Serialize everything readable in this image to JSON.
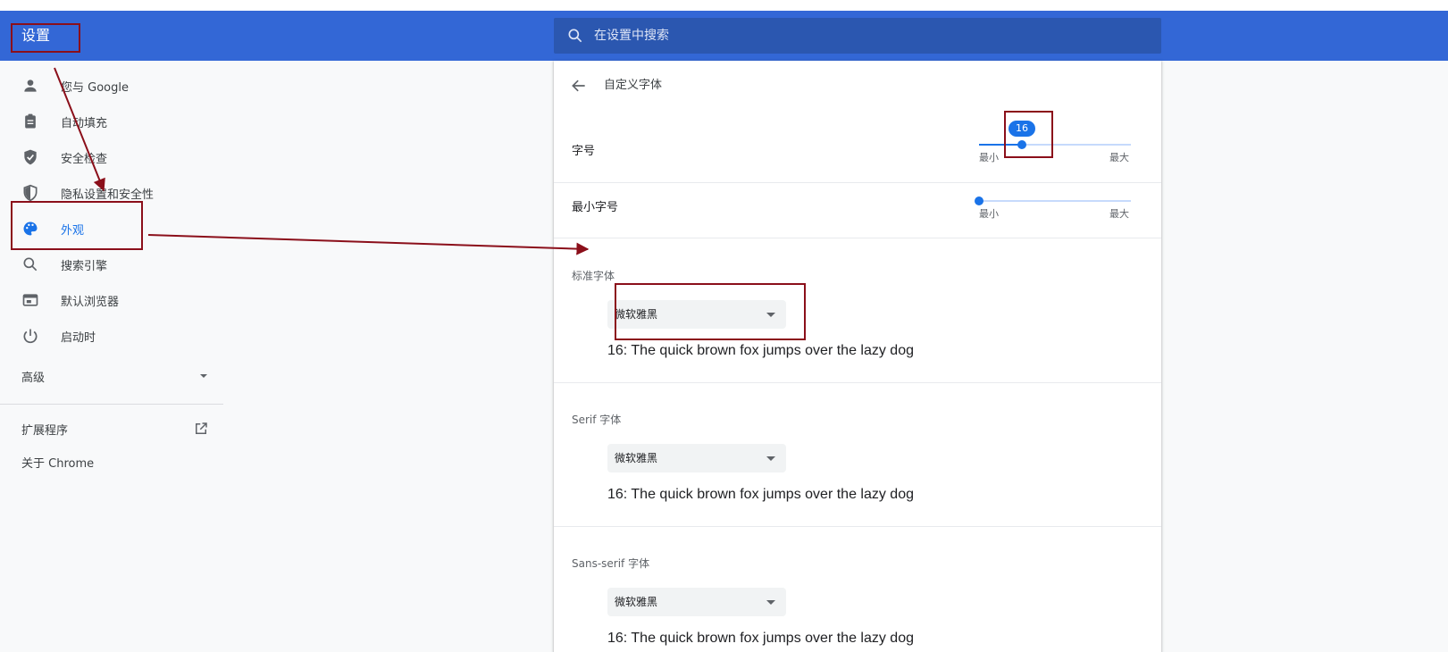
{
  "app": {
    "title": "设置"
  },
  "search": {
    "placeholder": "在设置中搜索",
    "icon": "search-icon"
  },
  "sidebar": {
    "items": [
      {
        "label": "您与 Google",
        "icon": "person-icon"
      },
      {
        "label": "自动填充",
        "icon": "clipboard-icon"
      },
      {
        "label": "安全检查",
        "icon": "shield-check-icon"
      },
      {
        "label": "隐私设置和安全性",
        "icon": "shield-half-icon"
      },
      {
        "label": "外观",
        "icon": "palette-icon",
        "active": true
      },
      {
        "label": "搜索引擎",
        "icon": "search-icon"
      },
      {
        "label": "默认浏览器",
        "icon": "browser-icon"
      },
      {
        "label": "启动时",
        "icon": "power-icon"
      }
    ],
    "advanced_label": "高级",
    "extensions_label": "扩展程序",
    "about_label": "关于 Chrome"
  },
  "subpage": {
    "title": "自定义字体",
    "font_size": {
      "label": "字号",
      "value": "16",
      "position_fraction": 0.28,
      "min_label": "最小",
      "max_label": "最大"
    },
    "min_font_size": {
      "label": "最小字号",
      "position_fraction": 0.0,
      "min_label": "最小",
      "max_label": "最大"
    },
    "standard": {
      "label": "标准字体",
      "value": "微软雅黑",
      "sample": "16: The quick brown fox jumps over the lazy dog"
    },
    "serif": {
      "label": "Serif 字体",
      "value": "微软雅黑",
      "sample": "16: The quick brown fox jumps over the lazy dog"
    },
    "sans_serif": {
      "label": "Sans-serif 字体",
      "value": "微软雅黑",
      "sample": "16: The quick brown fox jumps over the lazy dog"
    }
  },
  "colors": {
    "header": "#3367d6",
    "accent": "#1a73e8",
    "annotation": "#8b0f1a"
  }
}
